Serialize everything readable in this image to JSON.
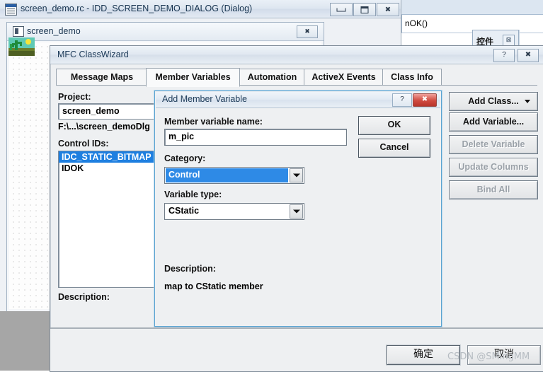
{
  "background_ide": {
    "code_text": "nOK()",
    "controls_palette": {
      "title": "控件",
      "close_label": "⊠"
    }
  },
  "rc_window": {
    "title": "screen_demo.rc - IDD_SCREEN_DEMO_DIALOG (Dialog)",
    "icon": "resource-script-icon",
    "buttons": {
      "minimize": "",
      "maximize": "",
      "close": "✖"
    },
    "editor": {
      "title": "screen_demo",
      "icon": "dialog-icon",
      "close_label": "✖",
      "bitmap_control": "desert-cactus-bitmap"
    },
    "ok_button_cn": "确定",
    "cancel_button_cn": "取消"
  },
  "classwizard": {
    "title": "MFC ClassWizard",
    "help_label": "?",
    "close_label": "✖",
    "tabs": [
      {
        "label": "Message Maps",
        "selected": false
      },
      {
        "label": "Member Variables",
        "selected": true
      },
      {
        "label": "Automation",
        "selected": false
      },
      {
        "label": "ActiveX Events",
        "selected": false
      },
      {
        "label": "Class Info",
        "selected": false
      }
    ],
    "project_label": "Project:",
    "project_value": "screen_demo",
    "project_path": "F:\\...\\screen_demoDlg",
    "control_ids_label": "Control IDs:",
    "control_ids": [
      {
        "label": "IDC_STATIC_BITMAP",
        "selected": true
      },
      {
        "label": "IDOK",
        "selected": false
      }
    ],
    "description_label": "Description:",
    "buttons": [
      {
        "label": "Add Class...",
        "enabled": true,
        "has_dropdown": true
      },
      {
        "label": "Add Variable...",
        "enabled": true,
        "has_dropdown": false
      },
      {
        "label": "Delete Variable",
        "enabled": false,
        "has_dropdown": false
      },
      {
        "label": "Update Columns",
        "enabled": false,
        "has_dropdown": false
      },
      {
        "label": "Bind All",
        "enabled": false,
        "has_dropdown": false
      }
    ]
  },
  "add_member_variable": {
    "title": "Add Member Variable",
    "help_label": "?",
    "close_label": "✖",
    "name_label": "Member variable name:",
    "name_value": "m_pic",
    "name_placeholder": "",
    "category_label": "Category:",
    "category_value": "Control",
    "variable_type_label": "Variable type:",
    "variable_type_value": "CStatic",
    "description_label": "Description:",
    "description_text": "map to CStatic member",
    "ok_label": "OK",
    "cancel_label": "Cancel"
  },
  "watermark": {
    "text": "CSDN @SMingMM"
  },
  "colors": {
    "selection_blue": "#1e7fe0",
    "combo_selection": "#2e8ae6",
    "dialog_face": "#eef0f2",
    "close_red": "#cf4a3f",
    "accent_border": "#5ba3d0"
  }
}
